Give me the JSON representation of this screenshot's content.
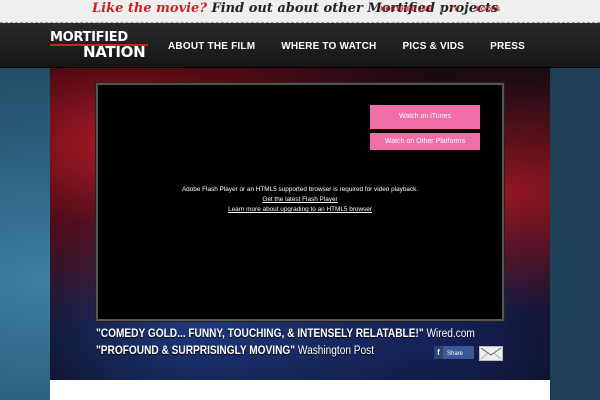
{
  "promo": {
    "part1": "Like the movie?",
    "part2": "Find out about other Mortified projects"
  },
  "top_links": [
    "MORTIFIED LIVE",
    "TV",
    "BOOKS"
  ],
  "logo": {
    "line1": "MORTIFIED",
    "line2": "NATION"
  },
  "nav": [
    "ABOUT THE FILM",
    "WHERE TO WATCH",
    "PICS & VIDS",
    "PRESS"
  ],
  "player": {
    "itunes_label": "Watch on iTunes",
    "other_label": "Watch on Other Platforms",
    "flash_message": "Adobe Flash Player or an HTML5 supported browser is required for video playback.",
    "flash_link": "Get the latest Flash Player",
    "html5_link": "Learn more about upgrading to an HTML5 browser"
  },
  "quotes": [
    {
      "quote": "\"COMEDY GOLD... FUNNY, TOUCHING, & INTENSELY RELATABLE!\"",
      "source": "Wired.com"
    },
    {
      "quote": "\"PROFOUND & SURPRISINGLY MOVING\"",
      "source": "Washington Post"
    }
  ],
  "share": {
    "label": "Share",
    "icon_letter": "f"
  },
  "colors": {
    "accent": "#cc2222",
    "button_pink": "#f06fa6",
    "facebook": "#3b5998"
  }
}
